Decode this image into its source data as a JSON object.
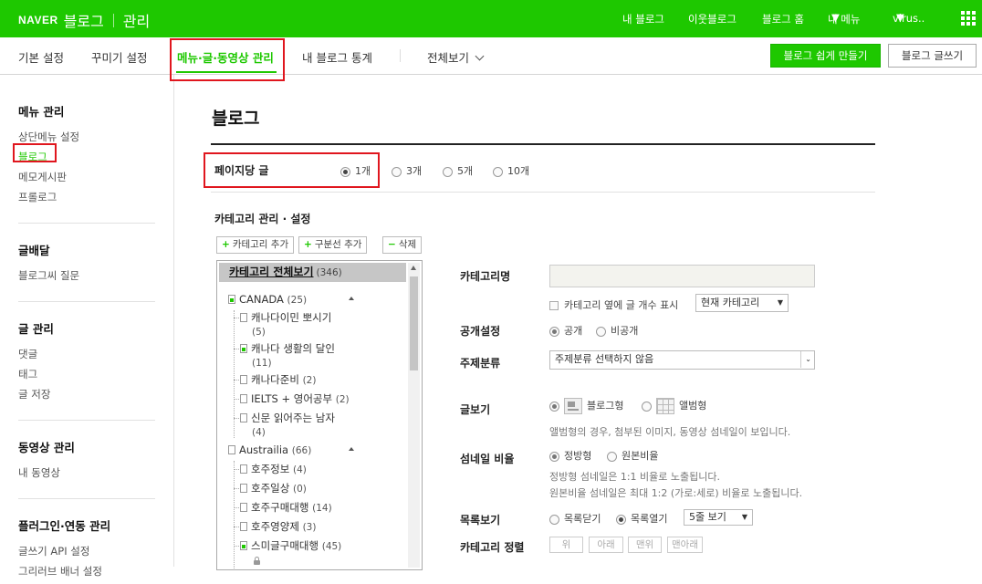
{
  "topbar": {
    "brand": "NAVER",
    "blog": "블로그",
    "admin": "관리",
    "nav": [
      "내 블로그",
      "이웃블로그",
      "블로그 홈",
      "내 메뉴",
      "virus.."
    ],
    "bg_color": "#1ec800"
  },
  "tabs": [
    "기본 설정",
    "꾸미기 설정",
    "메뉴·글·동영상 관리",
    "내 블로그 통계",
    "전체보기"
  ],
  "buttons": {
    "easy": "블로그 쉽게 만들기",
    "write": "블로그 글쓰기"
  },
  "sidebar": [
    {
      "title": "메뉴 관리",
      "items": [
        "상단메뉴 설정",
        "블로그",
        "메모게시판",
        "프롤로그"
      ]
    },
    {
      "title": "글배달",
      "items": [
        "블로그씨 질문"
      ]
    },
    {
      "title": "글 관리",
      "items": [
        "댓글",
        "태그",
        "글 저장"
      ]
    },
    {
      "title": "동영상 관리",
      "items": [
        "내 동영상"
      ]
    },
    {
      "title": "플러그인·연동 관리",
      "items": [
        "글쓰기 API 설정",
        "그리러브 배너 설정"
      ]
    }
  ],
  "page_title": "블로그",
  "per_page": {
    "label": "페이지당 글",
    "options": [
      "1개",
      "3개",
      "5개",
      "10개"
    ],
    "selected": "1개"
  },
  "category_section": {
    "title": "카테고리 관리 · 설정",
    "buttons": {
      "add_category": "카테고리 추가",
      "add_divider": "구분선 추가",
      "delete": "삭제"
    }
  },
  "tree": {
    "root": {
      "label": "카테고리 전체보기",
      "count": "(346)"
    },
    "nodes": [
      {
        "label": "CANADA",
        "count": "(25)"
      },
      {
        "label": "캐나다이민 뽀시기",
        "count": "(5)"
      },
      {
        "label": "캐나다 생활의 달인",
        "count": "(11)"
      },
      {
        "label": "캐나다준비",
        "count": "(2)"
      },
      {
        "label": "IELTS + 영어공부",
        "count": "(2)"
      },
      {
        "label": "신문 읽어주는 남자",
        "count": "(4)"
      },
      {
        "label": "Austrailia",
        "count": "(66)"
      },
      {
        "label": "호주정보",
        "count": "(4)"
      },
      {
        "label": "호주일상",
        "count": "(0)"
      },
      {
        "label": "호주구매대행",
        "count": "(14)"
      },
      {
        "label": "호주영양제",
        "count": "(3)"
      },
      {
        "label": "스미글구매대행",
        "count": "(45)"
      }
    ]
  },
  "settings": {
    "category_name": {
      "label": "카테고리명",
      "value": ""
    },
    "show_count": {
      "label": "카테고리 옆에 글 개수 표시",
      "select": "현재 카테고리"
    },
    "visibility": {
      "label": "공개설정",
      "options": [
        "공개",
        "비공개"
      ],
      "selected": "공개"
    },
    "topic": {
      "label": "주제분류",
      "select": "주제분류 선택하지 않음"
    },
    "view": {
      "label": "글보기",
      "options": [
        "블로그형",
        "앨범형"
      ],
      "selected": "블로그형",
      "desc": "앨범형의 경우, 첨부된 이미지, 동영상 섬네일이 보입니다."
    },
    "thumb": {
      "label": "섬네일 비율",
      "options": [
        "정방형",
        "원본비율"
      ],
      "selected": "정방형",
      "desc1": "정방형 섬네일은 1:1 비율로 노출됩니다.",
      "desc2": "원본비율 섬네일은 최대 1:2 (가로:세로) 비율로 노출됩니다."
    },
    "list": {
      "label": "목록보기",
      "options": [
        "목록닫기",
        "목록열기"
      ],
      "selected": "목록열기",
      "select": "5줄 보기"
    },
    "sort": {
      "label": "카테고리 정렬",
      "buttons": [
        "위",
        "아래",
        "맨위",
        "맨아래"
      ]
    }
  }
}
